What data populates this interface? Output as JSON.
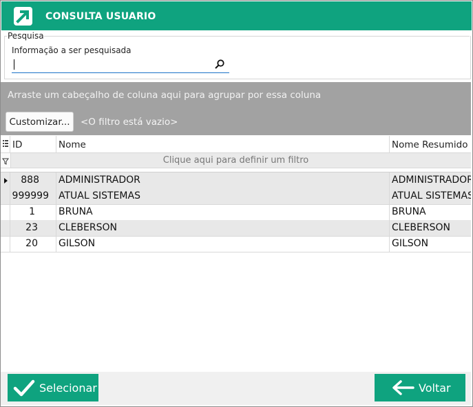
{
  "window": {
    "title": "CONSULTA USUARIO"
  },
  "search": {
    "group_label": "Pesquisa",
    "field_label": "Informação a ser pesquisada",
    "value": ""
  },
  "grouping": {
    "hint": "Arraste um cabeçalho de coluna aqui para agrupar por essa coluna",
    "customize_label": "Customizar...",
    "filter_status": "<O filtro está vazio>"
  },
  "grid": {
    "columns": [
      "ID",
      "Nome",
      "Nome Resumido"
    ],
    "filter_prompt": "Clique aqui para definir um filtro",
    "rows": [
      {
        "id": "888",
        "nome": "ADMINISTRADOR",
        "resumido": "ADMINISTRADOR",
        "current": true
      },
      {
        "id": "999999",
        "nome": "ATUAL SISTEMAS",
        "resumido": "ATUAL SISTEMAS",
        "current": false
      },
      {
        "id": "1",
        "nome": "BRUNA",
        "resumido": "BRUNA",
        "current": false
      },
      {
        "id": "23",
        "nome": "CLEBERSON",
        "resumido": "CLEBERSON",
        "current": false
      },
      {
        "id": "20",
        "nome": "GILSON",
        "resumido": "GILSON",
        "current": false
      }
    ]
  },
  "footer": {
    "select_label": "Selecionar",
    "back_label": "Voltar"
  },
  "colors": {
    "accent": "#0fa37f",
    "group_bar": "#a2a2a2"
  },
  "icons": [
    "app-logo-icon",
    "search-icon",
    "checkmark-icon",
    "arrow-left-icon",
    "column-chooser-icon",
    "filter-icon",
    "row-indicator-icon"
  ]
}
